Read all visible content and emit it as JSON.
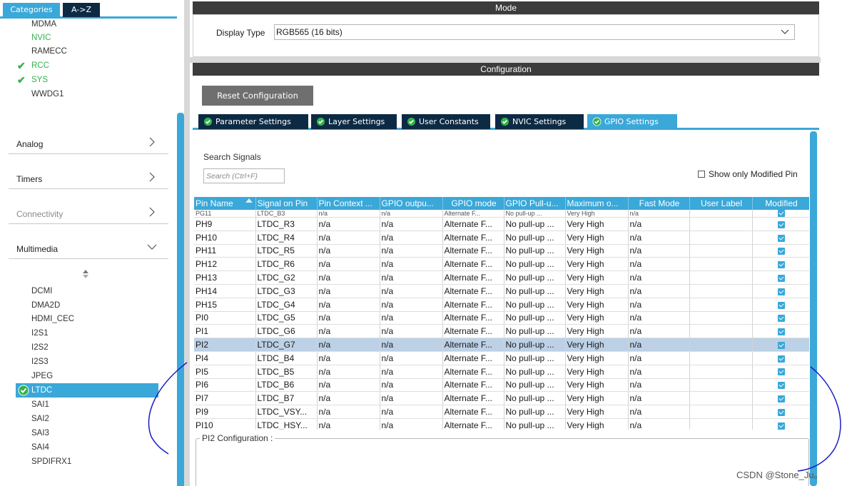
{
  "left_panel": {
    "tabs": [
      "Categories",
      "A->Z"
    ],
    "system_items": [
      {
        "label": "MDMA",
        "checked": false,
        "green": false
      },
      {
        "label": "NVIC",
        "checked": false,
        "green": true
      },
      {
        "label": "RAMECC",
        "checked": false,
        "green": false
      },
      {
        "label": "RCC",
        "checked": true,
        "green": true
      },
      {
        "label": "SYS",
        "checked": true,
        "green": true
      },
      {
        "label": "WWDG1",
        "checked": false,
        "green": false
      }
    ],
    "categories": [
      {
        "label": "Analog",
        "expanded": false
      },
      {
        "label": "Timers",
        "expanded": false
      },
      {
        "label": "Connectivity",
        "expanded": false
      },
      {
        "label": "Multimedia",
        "expanded": true
      }
    ],
    "multimedia_items": [
      "DCMI",
      "DMA2D",
      "HDMI_CEC",
      "I2S1",
      "I2S2",
      "I2S3",
      "JPEG",
      "LTDC",
      "SAI1",
      "SAI2",
      "SAI3",
      "SAI4",
      "SPDIFRX1"
    ],
    "selected_item": "LTDC"
  },
  "mode": {
    "title": "Mode",
    "display_type_label": "Display Type",
    "display_type_value": "RGB565 (16 bits)"
  },
  "configuration": {
    "title": "Configuration",
    "reset_label": "Reset Configuration",
    "tabs": [
      "Parameter Settings",
      "Layer Settings",
      "User Constants",
      "NVIC Settings",
      "GPIO Settings"
    ],
    "active_tab": "GPIO Settings",
    "search_label": "Search Signals",
    "search_placeholder": "Search (Ctrl+F)",
    "show_only_modified": "Show only Modified Pin"
  },
  "gpio_table": {
    "headers": [
      "Pin Name",
      "Signal on Pin",
      "Pin Context ...",
      "GPIO outpu...",
      "GPIO mode",
      "GPIO Pull-u...",
      "Maximum o...",
      "Fast Mode",
      "User Label",
      "Modified"
    ],
    "partial_row": [
      "PG11",
      "LTDC_B3",
      "n/a",
      "n/a",
      "Alternate F...",
      "No pull-up ...",
      "Very High",
      "n/a",
      "",
      true
    ],
    "rows": [
      [
        "PH9",
        "LTDC_R3",
        "n/a",
        "n/a",
        "Alternate F...",
        "No pull-up ...",
        "Very High",
        "n/a",
        "",
        true
      ],
      [
        "PH10",
        "LTDC_R4",
        "n/a",
        "n/a",
        "Alternate F...",
        "No pull-up ...",
        "Very High",
        "n/a",
        "",
        true
      ],
      [
        "PH11",
        "LTDC_R5",
        "n/a",
        "n/a",
        "Alternate F...",
        "No pull-up ...",
        "Very High",
        "n/a",
        "",
        true
      ],
      [
        "PH12",
        "LTDC_R6",
        "n/a",
        "n/a",
        "Alternate F...",
        "No pull-up ...",
        "Very High",
        "n/a",
        "",
        true
      ],
      [
        "PH13",
        "LTDC_G2",
        "n/a",
        "n/a",
        "Alternate F...",
        "No pull-up ...",
        "Very High",
        "n/a",
        "",
        true
      ],
      [
        "PH14",
        "LTDC_G3",
        "n/a",
        "n/a",
        "Alternate F...",
        "No pull-up ...",
        "Very High",
        "n/a",
        "",
        true
      ],
      [
        "PH15",
        "LTDC_G4",
        "n/a",
        "n/a",
        "Alternate F...",
        "No pull-up ...",
        "Very High",
        "n/a",
        "",
        true
      ],
      [
        "PI0",
        "LTDC_G5",
        "n/a",
        "n/a",
        "Alternate F...",
        "No pull-up ...",
        "Very High",
        "n/a",
        "",
        true
      ],
      [
        "PI1",
        "LTDC_G6",
        "n/a",
        "n/a",
        "Alternate F...",
        "No pull-up ...",
        "Very High",
        "n/a",
        "",
        true
      ],
      [
        "PI2",
        "LTDC_G7",
        "n/a",
        "n/a",
        "Alternate F...",
        "No pull-up ...",
        "Very High",
        "n/a",
        "",
        true
      ],
      [
        "PI4",
        "LTDC_B4",
        "n/a",
        "n/a",
        "Alternate F...",
        "No pull-up ...",
        "Very High",
        "n/a",
        "",
        true
      ],
      [
        "PI5",
        "LTDC_B5",
        "n/a",
        "n/a",
        "Alternate F...",
        "No pull-up ...",
        "Very High",
        "n/a",
        "",
        true
      ],
      [
        "PI6",
        "LTDC_B6",
        "n/a",
        "n/a",
        "Alternate F...",
        "No pull-up ...",
        "Very High",
        "n/a",
        "",
        true
      ],
      [
        "PI7",
        "LTDC_B7",
        "n/a",
        "n/a",
        "Alternate F...",
        "No pull-up ...",
        "Very High",
        "n/a",
        "",
        true
      ],
      [
        "PI9",
        "LTDC_VSY...",
        "n/a",
        "n/a",
        "Alternate F...",
        "No pull-up ...",
        "Very High",
        "n/a",
        "",
        true
      ],
      [
        "PI10",
        "LTDC_HSY...",
        "n/a",
        "n/a",
        "Alternate F...",
        "No pull-up ...",
        "Very High",
        "n/a",
        "",
        true
      ]
    ],
    "selected_row": "PI2"
  },
  "pin_config": {
    "title": "PI2 Configuration :"
  },
  "watermark": "CSDN @Stone_Ju。",
  "colors": {
    "accent": "#3aa8d8",
    "dark_tab": "#0d2a44",
    "header_bar": "#3c3c3c",
    "ok_green": "#33b24a",
    "selected_row": "#bcd1e6",
    "annotation": "#1b1bc9"
  }
}
